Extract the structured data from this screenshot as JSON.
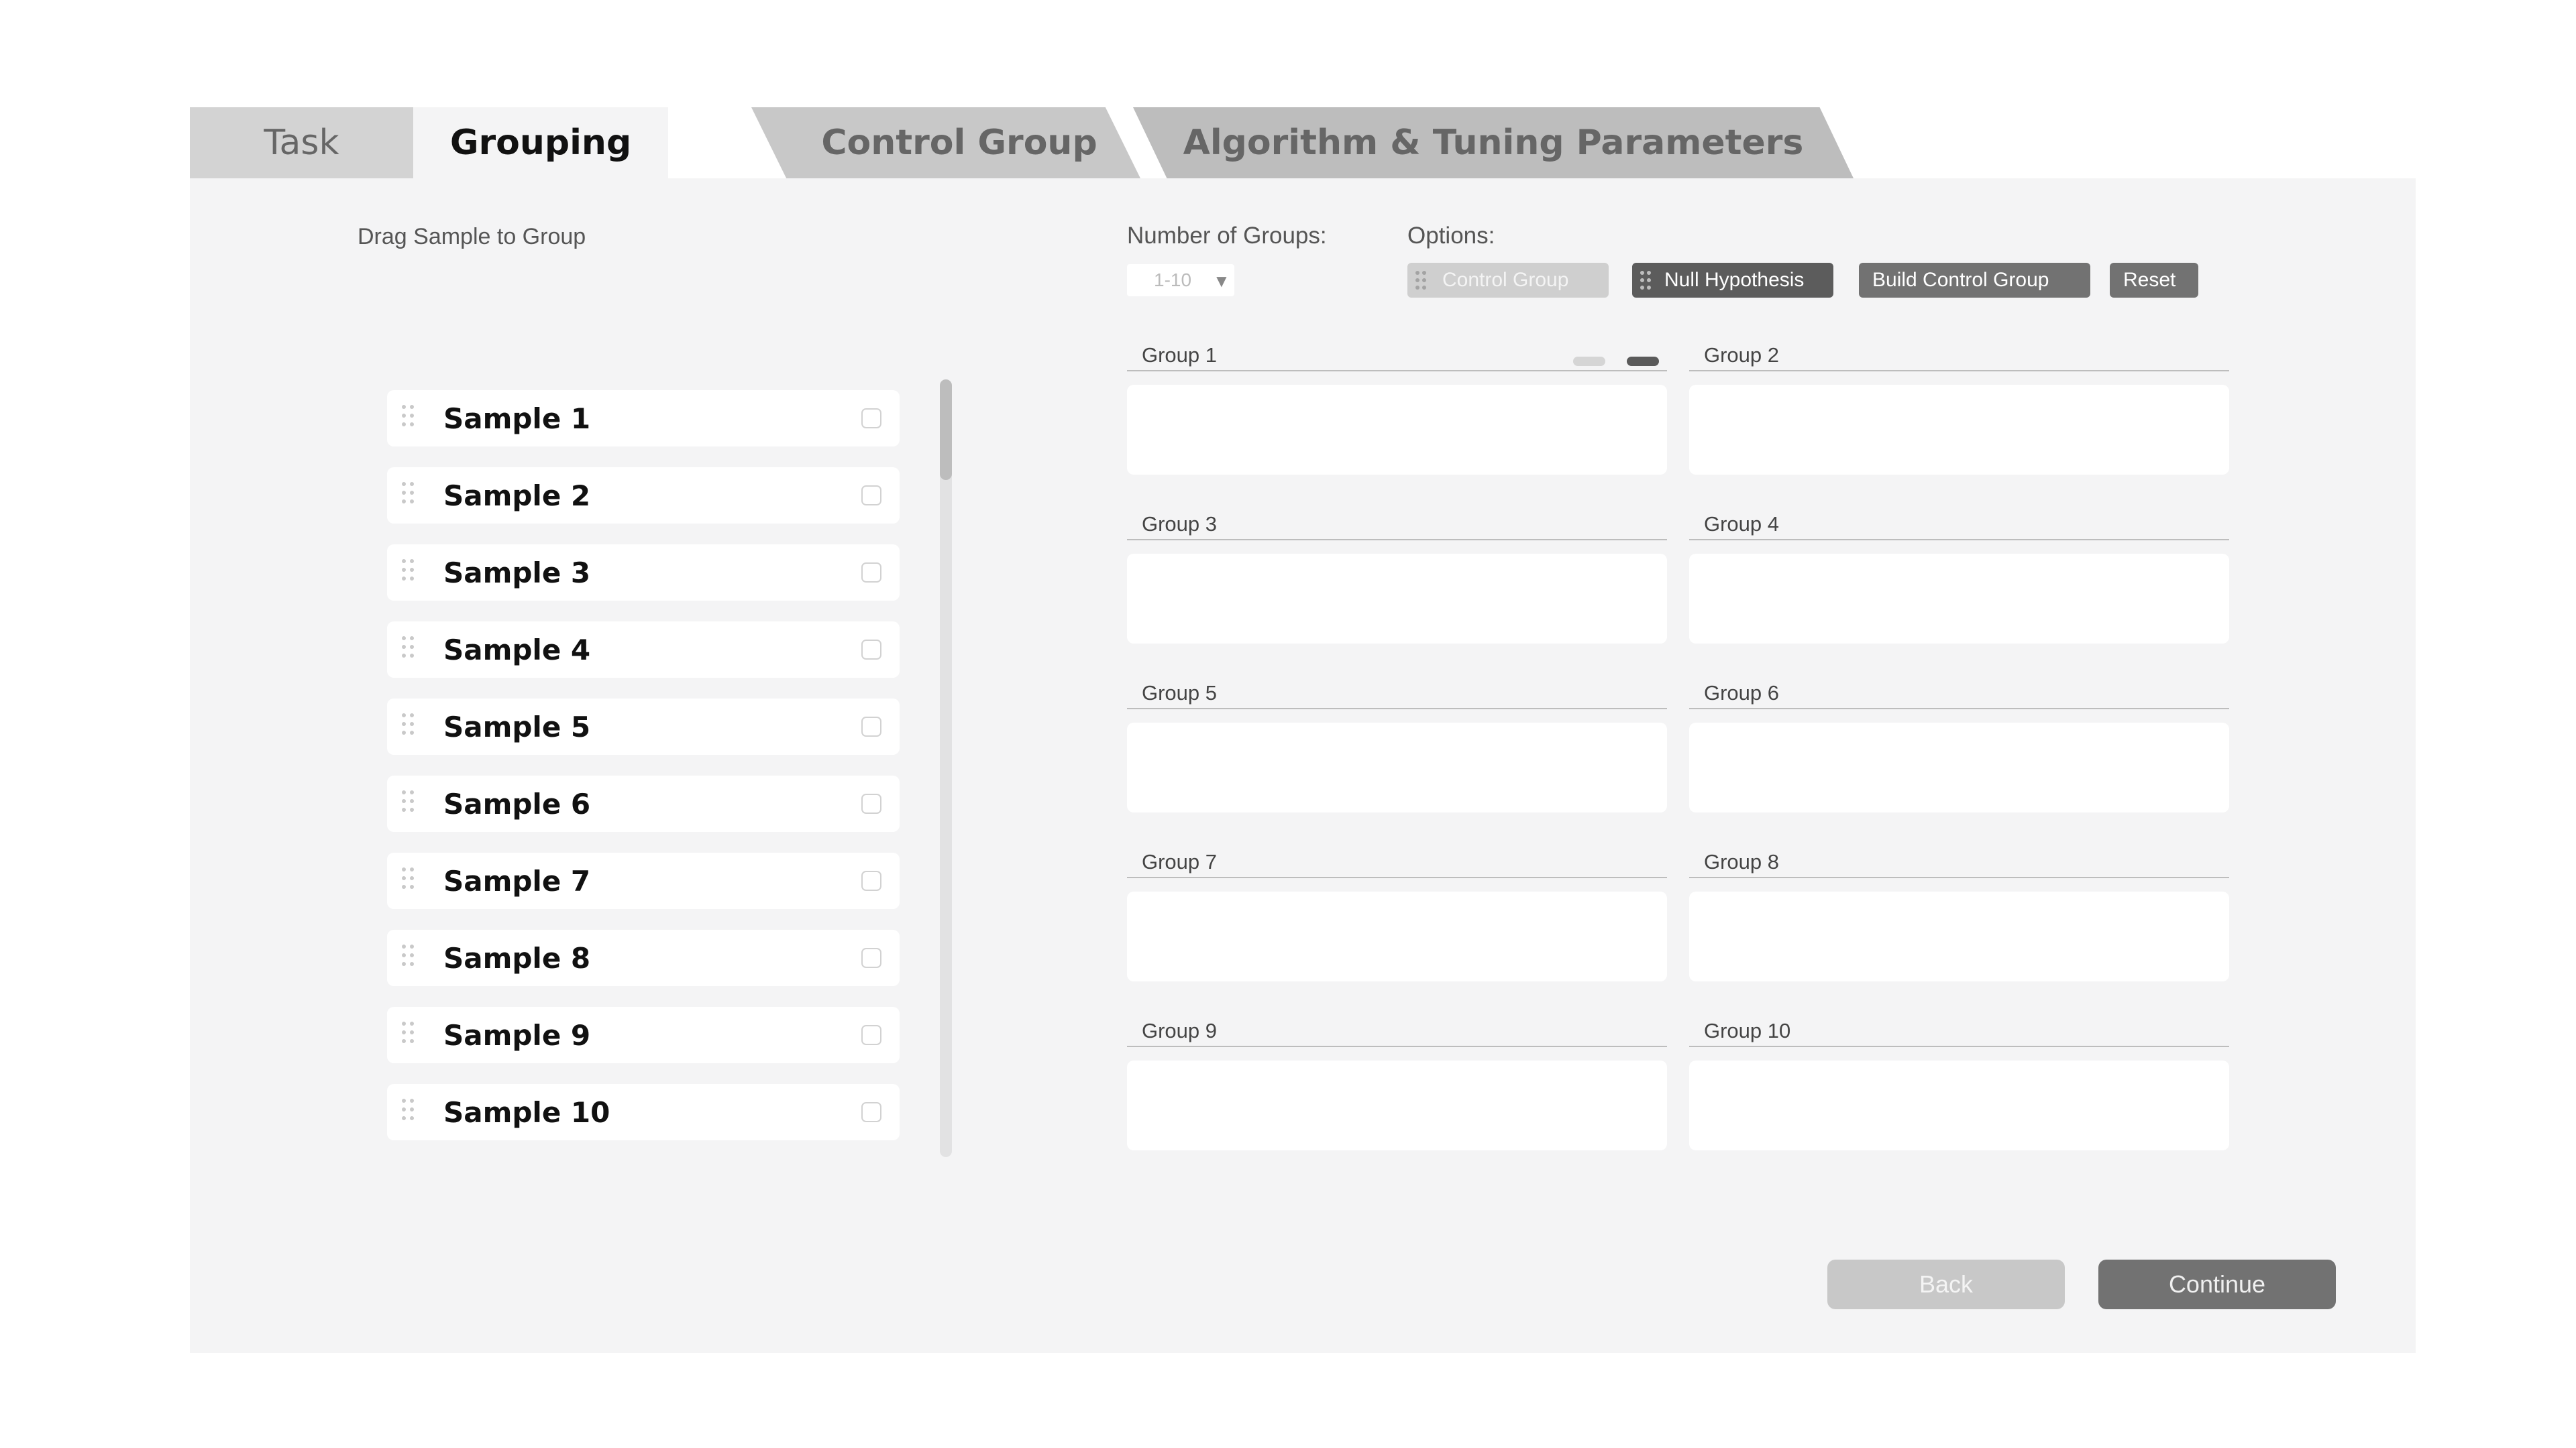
{
  "tabs": [
    {
      "label": "Task"
    },
    {
      "label": "Grouping"
    },
    {
      "label": "Control Group"
    },
    {
      "label": "Algorithm & Tuning Parameters"
    }
  ],
  "drag_label": "Drag Sample to Group",
  "samples": [
    {
      "label": "Sample 1"
    },
    {
      "label": "Sample 2"
    },
    {
      "label": "Sample 3"
    },
    {
      "label": "Sample 4"
    },
    {
      "label": "Sample 5"
    },
    {
      "label": "Sample 6"
    },
    {
      "label": "Sample 7"
    },
    {
      "label": "Sample 8"
    },
    {
      "label": "Sample 9"
    },
    {
      "label": "Sample 10"
    }
  ],
  "num_groups": {
    "label": "Number of Groups:",
    "value": "1-10"
  },
  "options": {
    "label": "Options:",
    "control_group": "Control Group",
    "null_hypothesis": "Null Hypothesis",
    "build_control_group": "Build Control Group",
    "reset": "Reset"
  },
  "groups": [
    {
      "title": "Group 1"
    },
    {
      "title": "Group 2"
    },
    {
      "title": "Group 3"
    },
    {
      "title": "Group 4"
    },
    {
      "title": "Group 5"
    },
    {
      "title": "Group 6"
    },
    {
      "title": "Group 7"
    },
    {
      "title": "Group 8"
    },
    {
      "title": "Group 9"
    },
    {
      "title": "Group 10"
    }
  ],
  "footer": {
    "back": "Back",
    "continue": "Continue"
  },
  "colors": {
    "panel": "#f4f4f5",
    "active_button": "#5c5c5c",
    "button": "#727272",
    "disabled_button": "#c8c8c8"
  }
}
